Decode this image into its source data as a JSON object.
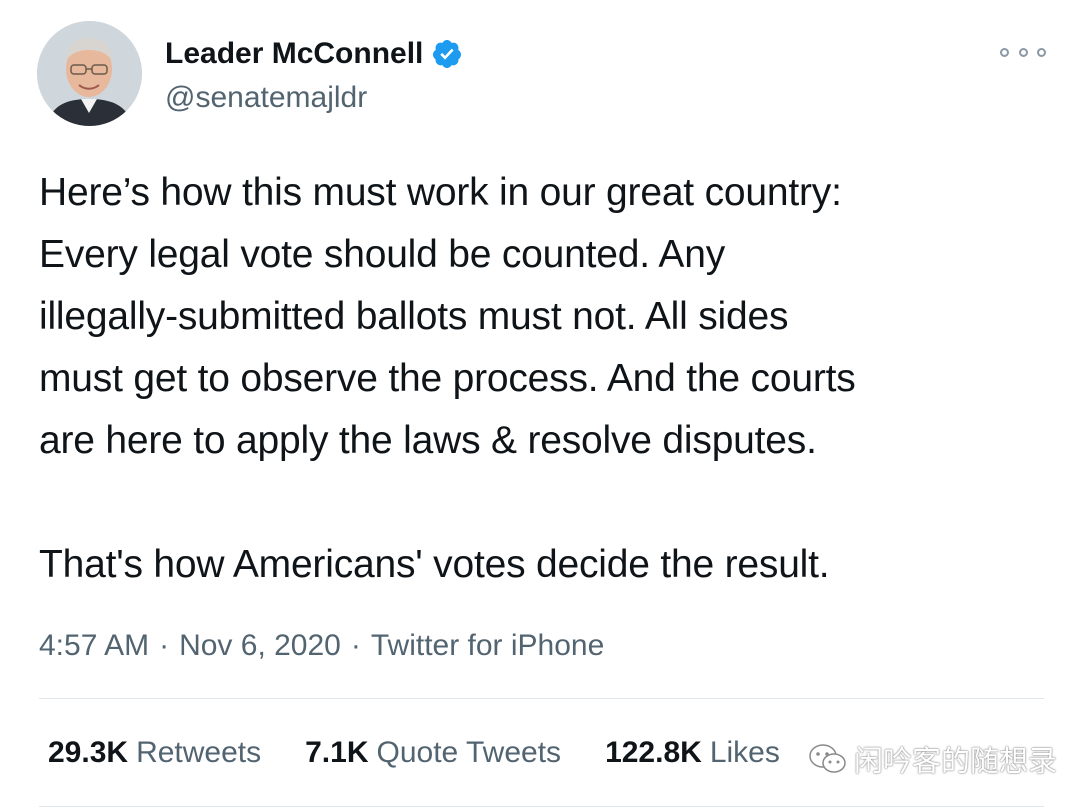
{
  "author": {
    "name": "Leader McConnell",
    "handle": "@senatemajldr",
    "verified_color": "#1d9bf0"
  },
  "tweet": {
    "paragraph_1": "Here’s how this must work in our great country:\nEvery legal vote should be counted. Any\nillegally-submitted ballots must not. All sides\nmust get to observe the process. And the courts\nare here to apply the laws & resolve disputes.",
    "paragraph_2": "That's how Americans' votes decide the result."
  },
  "meta": {
    "time": "4:57 AM",
    "separator": "·",
    "date": "Nov 6, 2020",
    "source": "Twitter for iPhone"
  },
  "stats": {
    "retweets": {
      "count": "29.3K",
      "label": "Retweets"
    },
    "quotes": {
      "count": "7.1K",
      "label": "Quote Tweets"
    },
    "likes": {
      "count": "122.8K",
      "label": "Likes"
    }
  },
  "watermark": {
    "text": "闲吟客的随想录",
    "icon": "wechat-icon"
  },
  "icons": {
    "more": "more-options-icon",
    "verified": "verified-badge-icon"
  },
  "colors": {
    "text": "#0f1419",
    "secondary": "#536471",
    "divider": "#e1e6ea",
    "accent": "#1d9bf0"
  }
}
